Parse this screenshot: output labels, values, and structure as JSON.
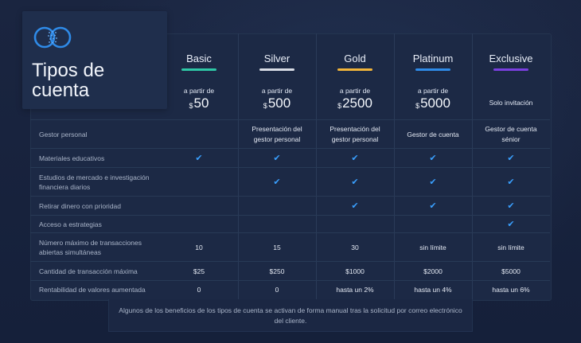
{
  "title": "Tipos de cuenta",
  "plans": [
    {
      "name": "Basic",
      "from": "a partir de",
      "currency": "$",
      "price": "50",
      "bar_color": "#2ec7a6"
    },
    {
      "name": "Silver",
      "from": "a partir de",
      "currency": "$",
      "price": "500",
      "bar_color": "#d9dde6"
    },
    {
      "name": "Gold",
      "from": "a partir de",
      "currency": "$",
      "price": "2500",
      "bar_color": "#f1b43a"
    },
    {
      "name": "Platinum",
      "from": "a partir de",
      "currency": "$",
      "price": "5000",
      "bar_color": "#2f8be8"
    },
    {
      "name": "Exclusive",
      "invite": "Solo invitación",
      "bar_color": "#7a3fe0"
    }
  ],
  "rows": [
    {
      "label": "Gestor personal",
      "cells": [
        "",
        "Presentación del gestor personal",
        "Presentación del gestor personal",
        "Gestor de cuenta",
        "Gestor de cuenta sénior"
      ]
    },
    {
      "label": "Materiales educativos",
      "cells": [
        "✔",
        "✔",
        "✔",
        "✔",
        "✔"
      ]
    },
    {
      "label": "Estudios de mercado e investigación financiera diarios",
      "cells": [
        "",
        "✔",
        "✔",
        "✔",
        "✔"
      ]
    },
    {
      "label": "Retirar dinero con prioridad",
      "cells": [
        "",
        "",
        "✔",
        "✔",
        "✔"
      ]
    },
    {
      "label": "Acceso a estrategias",
      "cells": [
        "",
        "",
        "",
        "",
        "✔"
      ]
    },
    {
      "label": "Número máximo de transacciones abiertas simultáneas",
      "cells": [
        "10",
        "15",
        "30",
        "sin límite",
        "sin límite"
      ]
    },
    {
      "label": "Cantidad de transacción máxima",
      "cells": [
        "$25",
        "$250",
        "$1000",
        "$2000",
        "$5000"
      ]
    },
    {
      "label": "Rentabilidad de valores aumentada",
      "cells": [
        "0",
        "0",
        "hasta un 2%",
        "hasta un 4%",
        "hasta un 6%"
      ]
    }
  ],
  "footnote": "Algunos de los beneficios de los tipos de cuenta se activan de forma manual tras la solicitud por correo electrónico del cliente.",
  "colors": {
    "accent": "#3aa0ff",
    "background": "#17213a",
    "panel": "#1c2945"
  }
}
